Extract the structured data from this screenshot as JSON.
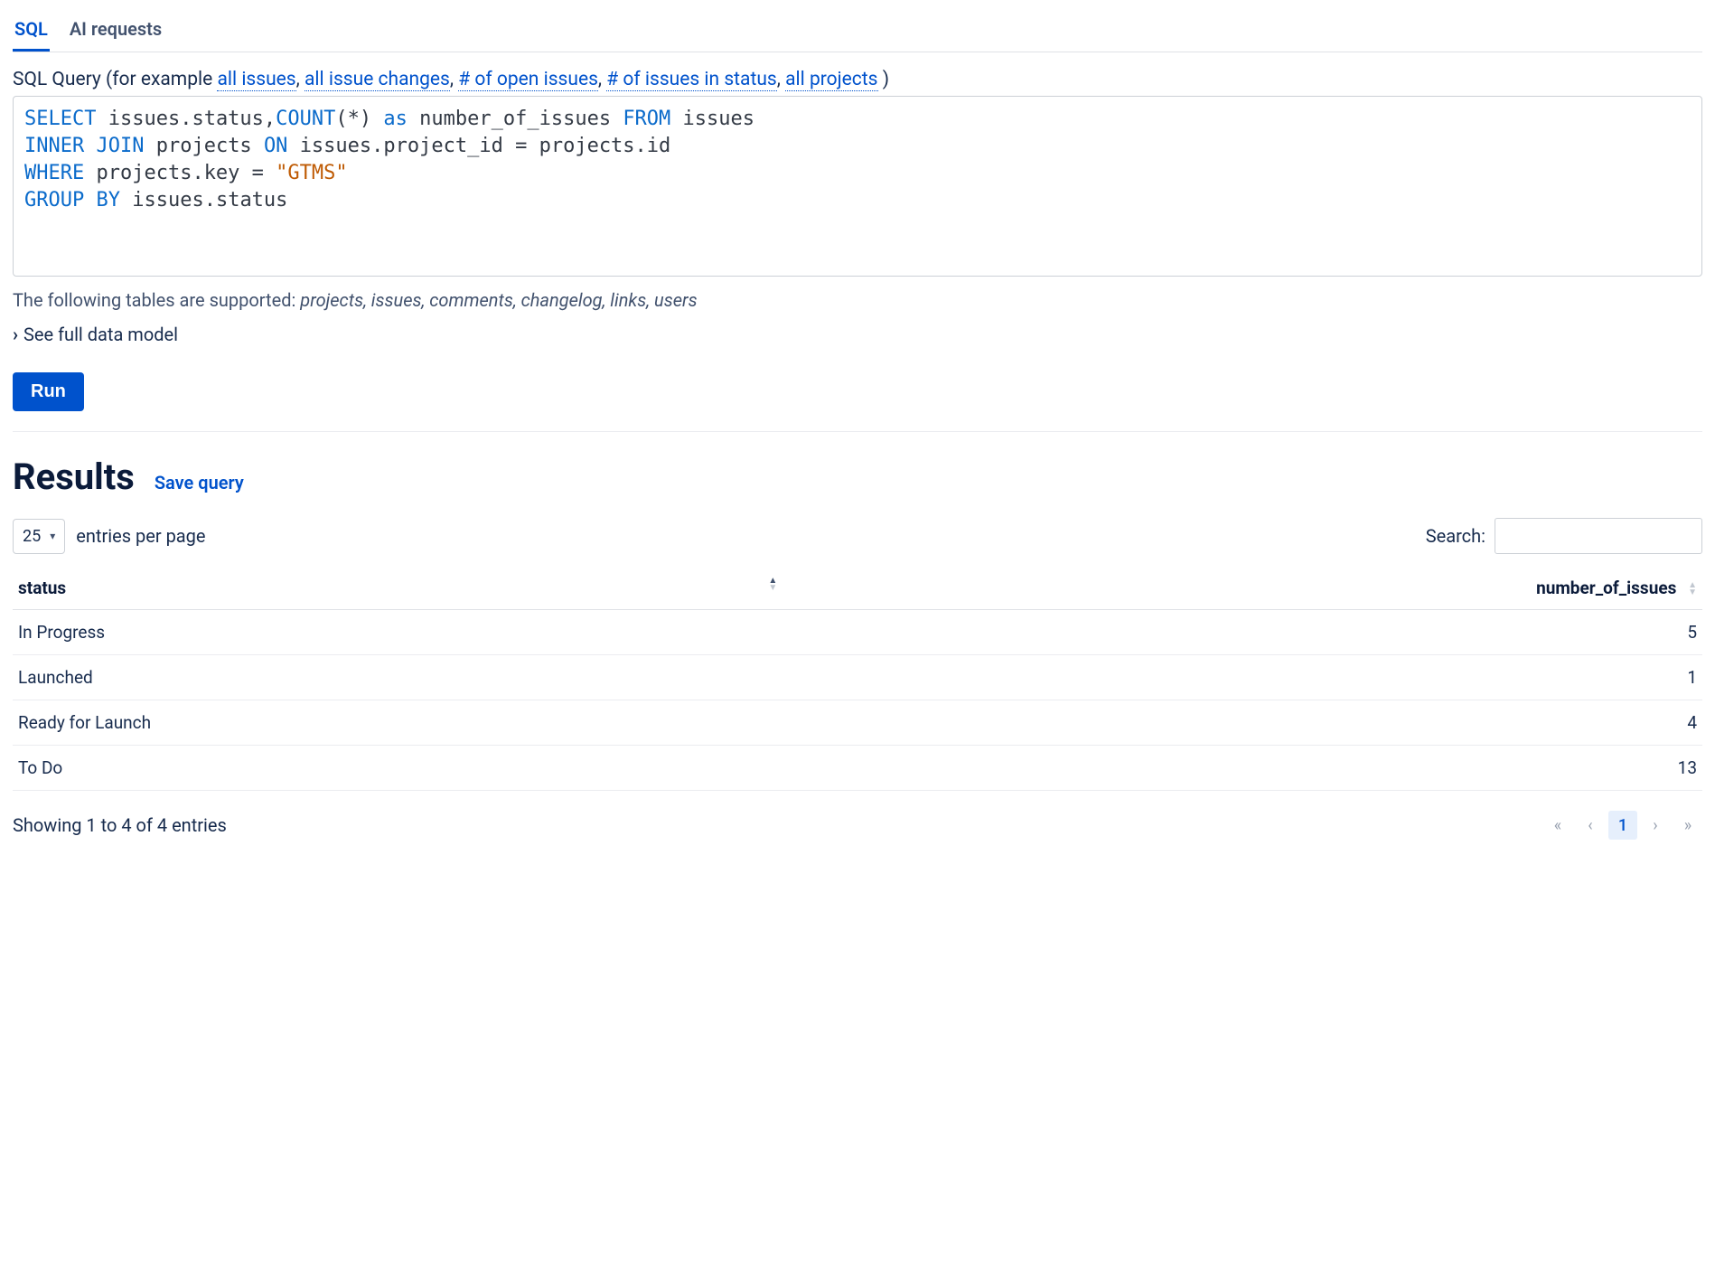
{
  "tabs": {
    "sql": "SQL",
    "ai": "AI requests"
  },
  "query": {
    "label_prefix": "SQL Query (for example ",
    "examples": [
      "all issues",
      "all issue changes",
      "# of open issues",
      "# of issues in status",
      "all projects"
    ],
    "label_suffix": " )",
    "sql_tokens": [
      [
        "kw",
        "SELECT"
      ],
      [
        " ",
        " "
      ],
      [
        "id",
        "issues.status,"
      ],
      [
        "kw",
        "COUNT"
      ],
      [
        "id",
        "(*) "
      ],
      [
        "kw",
        "as"
      ],
      [
        " ",
        " "
      ],
      [
        "id",
        "number_of_issues "
      ],
      [
        "kw",
        "FROM"
      ],
      [
        " ",
        " "
      ],
      [
        "id",
        "issues"
      ],
      [
        "nl",
        ""
      ],
      [
        "kw",
        "INNER"
      ],
      [
        " ",
        " "
      ],
      [
        "kw",
        "JOIN"
      ],
      [
        " ",
        " "
      ],
      [
        "id",
        "projects "
      ],
      [
        "kw",
        "ON"
      ],
      [
        " ",
        " "
      ],
      [
        "id",
        "issues.project_id = projects.id"
      ],
      [
        "nl",
        ""
      ],
      [
        "kw",
        "WHERE"
      ],
      [
        " ",
        " "
      ],
      [
        "id",
        "projects.key = "
      ],
      [
        "str",
        "\"GTMS\""
      ],
      [
        "nl",
        ""
      ],
      [
        "kw",
        "GROUP"
      ],
      [
        " ",
        " "
      ],
      [
        "kw",
        "BY"
      ],
      [
        " ",
        " "
      ],
      [
        "id",
        "issues.status"
      ]
    ]
  },
  "supported": {
    "prefix": "The following tables are supported: ",
    "tables": "projects, issues, comments, changelog, links, users"
  },
  "datamodel_label": "See full data model",
  "run_label": "Run",
  "results": {
    "heading": "Results",
    "save_label": "Save query",
    "page_size": "25",
    "entries_label": "entries per page",
    "search_label": "Search:",
    "search_value": "",
    "columns": [
      "status",
      "number_of_issues"
    ],
    "rows": [
      {
        "status": "In Progress",
        "number_of_issues": "5"
      },
      {
        "status": "Launched",
        "number_of_issues": "1"
      },
      {
        "status": "Ready for Launch",
        "number_of_issues": "4"
      },
      {
        "status": "To Do",
        "number_of_issues": "13"
      }
    ],
    "showing": "Showing 1 to 4 of 4 entries",
    "pager": {
      "first": "«",
      "prev": "‹",
      "page": "1",
      "next": "›",
      "last": "»"
    }
  }
}
